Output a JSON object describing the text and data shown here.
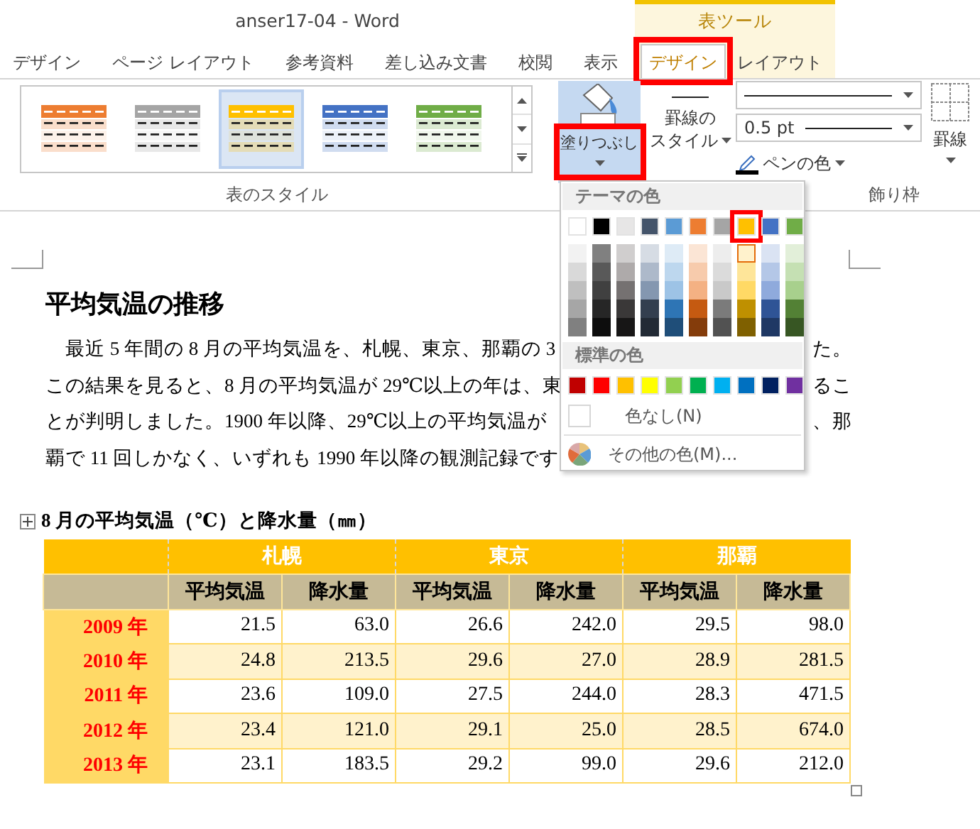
{
  "window": {
    "title": "anser17-04 - Word"
  },
  "contextual_tab_group": {
    "label": "表ツール"
  },
  "tabs": [
    {
      "label": "デザイン",
      "selected": false,
      "contextual": false,
      "highlighted": false
    },
    {
      "label": "ページ レイアウト",
      "selected": false,
      "contextual": false,
      "highlighted": false
    },
    {
      "label": "参考資料",
      "selected": false,
      "contextual": false,
      "highlighted": false
    },
    {
      "label": "差し込み文書",
      "selected": false,
      "contextual": false,
      "highlighted": false
    },
    {
      "label": "校閲",
      "selected": false,
      "contextual": false,
      "highlighted": false
    },
    {
      "label": "表示",
      "selected": false,
      "contextual": false,
      "highlighted": false
    },
    {
      "label": "デザイン",
      "selected": true,
      "contextual": true,
      "highlighted": true
    },
    {
      "label": "レイアウト",
      "selected": false,
      "contextual": true,
      "highlighted": false
    }
  ],
  "ribbon": {
    "table_styles": {
      "group_label": "表のスタイル",
      "styles": [
        {
          "color": "#ed7d31",
          "selected": false
        },
        {
          "color": "#a5a5a5",
          "selected": false
        },
        {
          "color": "#ffc000",
          "selected": true
        },
        {
          "color": "#4472c4",
          "selected": false
        },
        {
          "color": "#70ad47",
          "selected": false
        }
      ]
    },
    "shading_button": {
      "label": "塗りつぶし",
      "pressed": true,
      "highlighted": true
    },
    "border_style_button": {
      "label": [
        "罫線の",
        "スタイル"
      ]
    },
    "line_weight_dropdown": {
      "value": "0.5 pt"
    },
    "pen_color_button": {
      "label": "ペンの色"
    },
    "borders_button": {
      "label": "罫線"
    },
    "borders_group_label": "飾り枠"
  },
  "color_menu": {
    "theme_header": "テーマの色",
    "theme_colors": [
      {
        "color": "#ffffff",
        "selected": false,
        "shades": [
          {
            "color": "#f2f2f2",
            "hovered": false
          },
          {
            "color": "#d9d9d9",
            "hovered": false
          },
          {
            "color": "#bfbfbf",
            "hovered": false
          },
          {
            "color": "#a6a6a6",
            "hovered": false
          },
          {
            "color": "#808080",
            "hovered": false
          }
        ]
      },
      {
        "color": "#000000",
        "selected": false,
        "shades": [
          {
            "color": "#808080",
            "hovered": false
          },
          {
            "color": "#595959",
            "hovered": false
          },
          {
            "color": "#404040",
            "hovered": false
          },
          {
            "color": "#262626",
            "hovered": false
          },
          {
            "color": "#0d0d0d",
            "hovered": false
          }
        ]
      },
      {
        "color": "#e7e6e6",
        "selected": false,
        "shades": [
          {
            "color": "#d0cece",
            "hovered": false
          },
          {
            "color": "#aeaaaa",
            "hovered": false
          },
          {
            "color": "#757171",
            "hovered": false
          },
          {
            "color": "#3a3838",
            "hovered": false
          },
          {
            "color": "#171616",
            "hovered": false
          }
        ]
      },
      {
        "color": "#44546a",
        "selected": false,
        "shades": [
          {
            "color": "#d6dce4",
            "hovered": false
          },
          {
            "color": "#adb9ca",
            "hovered": false
          },
          {
            "color": "#8497b0",
            "hovered": false
          },
          {
            "color": "#333f4f",
            "hovered": false
          },
          {
            "color": "#222a35",
            "hovered": false
          }
        ]
      },
      {
        "color": "#5b9bd5",
        "selected": false,
        "shades": [
          {
            "color": "#deebf6",
            "hovered": false
          },
          {
            "color": "#bdd7ee",
            "hovered": false
          },
          {
            "color": "#9dc3e6",
            "hovered": false
          },
          {
            "color": "#2e75b5",
            "hovered": false
          },
          {
            "color": "#1f4e79",
            "hovered": false
          }
        ]
      },
      {
        "color": "#ed7d31",
        "selected": false,
        "shades": [
          {
            "color": "#fbe5d5",
            "hovered": false
          },
          {
            "color": "#f7cbac",
            "hovered": false
          },
          {
            "color": "#f4b183",
            "hovered": false
          },
          {
            "color": "#c55a11",
            "hovered": false
          },
          {
            "color": "#843c0b",
            "hovered": false
          }
        ]
      },
      {
        "color": "#a5a5a5",
        "selected": false,
        "shades": [
          {
            "color": "#ededed",
            "hovered": false
          },
          {
            "color": "#dbdbdb",
            "hovered": false
          },
          {
            "color": "#c9c9c9",
            "hovered": false
          },
          {
            "color": "#7b7b7b",
            "hovered": false
          },
          {
            "color": "#525252",
            "hovered": false
          }
        ]
      },
      {
        "color": "#ffc000",
        "selected": true,
        "shades": [
          {
            "color": "#fff2cc",
            "hovered": true
          },
          {
            "color": "#fee599",
            "hovered": false
          },
          {
            "color": "#ffd965",
            "hovered": false
          },
          {
            "color": "#bf9000",
            "hovered": false
          },
          {
            "color": "#7f6000",
            "hovered": false
          }
        ]
      },
      {
        "color": "#4472c4",
        "selected": false,
        "shades": [
          {
            "color": "#dae3f3",
            "hovered": false
          },
          {
            "color": "#b4c7e7",
            "hovered": false
          },
          {
            "color": "#8faadc",
            "hovered": false
          },
          {
            "color": "#2f5496",
            "hovered": false
          },
          {
            "color": "#1f3864",
            "hovered": false
          }
        ]
      },
      {
        "color": "#70ad47",
        "selected": false,
        "shades": [
          {
            "color": "#e2efd9",
            "hovered": false
          },
          {
            "color": "#c5e0b3",
            "hovered": false
          },
          {
            "color": "#a8d08d",
            "hovered": false
          },
          {
            "color": "#538135",
            "hovered": false
          },
          {
            "color": "#375623",
            "hovered": false
          }
        ]
      }
    ],
    "standard_header": "標準の色",
    "standard_colors": [
      {
        "color": "#c00000"
      },
      {
        "color": "#ff0000"
      },
      {
        "color": "#ffc000"
      },
      {
        "color": "#ffff00"
      },
      {
        "color": "#92d050"
      },
      {
        "color": "#00b050"
      },
      {
        "color": "#00b0f0"
      },
      {
        "color": "#0070c0"
      },
      {
        "color": "#002060"
      },
      {
        "color": "#7030a0"
      }
    ],
    "no_color": "色なし(N)",
    "more_colors": "その他の色(M)..."
  },
  "document": {
    "heading": "平均気温の推移",
    "paragraph_lines": [
      {
        "left": "最近 5 年間の 8 月の平均気温を、札幌、東京、那覇の 3",
        "right": "た。"
      },
      {
        "left": "この結果を見ると、8 月の平均気温が 29℃以上の年は、東",
        "right": "るこ"
      },
      {
        "left": "とが判明しました。1900 年以降、29℃以上の平均気温が",
        "right": "、那"
      },
      {
        "left": "覇で 11 回しかなく、いずれも 1990 年以降の観測記録です"
      }
    ],
    "table_caption": "8 月の平均気温（℃）と降水量（㎜）",
    "table": {
      "cities": [
        "札幌",
        "東京",
        "那覇"
      ],
      "subheaders": [
        "平均気温",
        "降水量",
        "平均気温",
        "降水量",
        "平均気温",
        "降水量"
      ],
      "rows": [
        {
          "year": "2009 年",
          "banded": false,
          "values": [
            "21.5",
            "63.0",
            "26.6",
            "242.0",
            "29.5",
            "98.0"
          ]
        },
        {
          "year": "2010 年",
          "banded": true,
          "values": [
            "24.8",
            "213.5",
            "29.6",
            "27.0",
            "28.9",
            "281.5"
          ]
        },
        {
          "year": "2011 年",
          "banded": false,
          "values": [
            "23.6",
            "109.0",
            "27.5",
            "244.0",
            "28.3",
            "471.5"
          ]
        },
        {
          "year": "2012 年",
          "banded": true,
          "values": [
            "23.4",
            "121.0",
            "29.1",
            "25.0",
            "28.5",
            "674.0"
          ]
        },
        {
          "year": "2013 年",
          "banded": false,
          "values": [
            "23.1",
            "183.5",
            "29.2",
            "99.0",
            "29.6",
            "212.0"
          ]
        }
      ]
    }
  }
}
